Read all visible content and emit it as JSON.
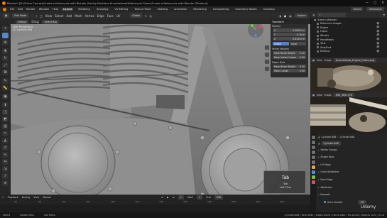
{
  "titlebar": {
    "text": "Blender* [D:\\Online Courses\\Create a Motorcycle with Blender (Harley-Davidson Knucklehead)\\Motorcycle Scene\\Create a Motorcycle with Blender 3D.blend]",
    "controls": [
      "—",
      "▢",
      "✕"
    ]
  },
  "menubar": {
    "items": [
      "File",
      "Edit",
      "Render",
      "Window",
      "Help"
    ],
    "workspaces": [
      "Layout",
      "Modeling",
      "Sculpting",
      "UV Editing",
      "Texture Paint",
      "Shading",
      "Animation",
      "Rendering",
      "Compositing",
      "Geometry Nodes",
      "Scripting"
    ],
    "active_workspace": "Layout",
    "scene": "Scene",
    "view_layer": "ViewLayer"
  },
  "viewport_header": {
    "mode": "Edit Mode",
    "menus": [
      "View",
      "Select",
      "Add",
      "Mesh",
      "Vertex",
      "Edge",
      "Face",
      "UV"
    ],
    "orientation": "Global",
    "options": "Options"
  },
  "viewport_header2": {
    "pivot": "Default",
    "drag": "Drag:",
    "select_box": "Select Box"
  },
  "viewport_overlay": {
    "line1": "User Perspective",
    "line2": "(1) Cylinder.006"
  },
  "npanel": {
    "title": "Transform",
    "median": "Median:",
    "rows": [
      {
        "label": "X",
        "value": "0.96951 m"
      },
      {
        "label": "Y",
        "value": "-0.10 m"
      },
      {
        "label": "Z",
        "value": "0.63315 m"
      }
    ],
    "global": "Global",
    "local": "Local",
    "vertex_weights_title": "Vertex Weights",
    "buttons_1": [
      "Mean Bevel Weight",
      "Mean Vertex Crease"
    ],
    "edges_title": "Edges Data",
    "buttons_2": [
      "Mean Bevel Weight",
      "Mean Crease"
    ],
    "values": [
      "0.00",
      "0.00",
      "0.00",
      "0.00"
    ]
  },
  "keycast": {
    "key": "Tab",
    "line2": "Tab",
    "line3": "Left Click"
  },
  "timeline": {
    "menus": [
      "Playback",
      "Keying",
      "View",
      "Marker"
    ],
    "frame_numbers": [
      "20",
      "40",
      "60",
      "80",
      "100",
      "120",
      "140",
      "160",
      "180",
      "200",
      "220",
      "240"
    ],
    "current_frame": "1",
    "start": "Start",
    "start_value": "1",
    "end": "End",
    "end_value": "250"
  },
  "statusbar": {
    "left": "Select",
    "middle": "Rotate View",
    "right": "Call Menu",
    "version": "Cylinder.006 | Verts 0/62 | Edges 0/124 | Faces 0/64 | Tris 0/120 | Objects 1/25 | 3.2.0"
  },
  "outliner": {
    "title": "Scene Collection",
    "items": [
      "Reference Images",
      "Engine",
      "Frame",
      "Wheels",
      "Handlebars",
      "Tank",
      "Seat/Fork",
      "Exhaust"
    ]
  },
  "image_editor_1": {
    "view": "View",
    "image": "Image",
    "name": "Knucklehead_Engine_Cases.png"
  },
  "image_editor_2": {
    "view": "View",
    "image": "Image",
    "name": "IMG_5851.JPG"
  },
  "properties": {
    "header_object": "Cylinder.006",
    "mesh_name": "Cylinder.006",
    "panels": [
      "Vertex Groups",
      "Shape Keys",
      "UV Maps",
      "Color Attributes",
      "Face Maps",
      "Attributes",
      "Normals"
    ],
    "auto_smooth_label": "Auto Smooth",
    "auto_smooth_value": "30°"
  },
  "watermark": "Udemy",
  "colors": {
    "accent": "#5680c2",
    "viewport_bg": "#7d7d7d",
    "active_orange": "#e8a33c",
    "axis_red": "#e24b5b",
    "axis_green": "#7fbf3f",
    "axis_blue": "#4a8de0"
  }
}
